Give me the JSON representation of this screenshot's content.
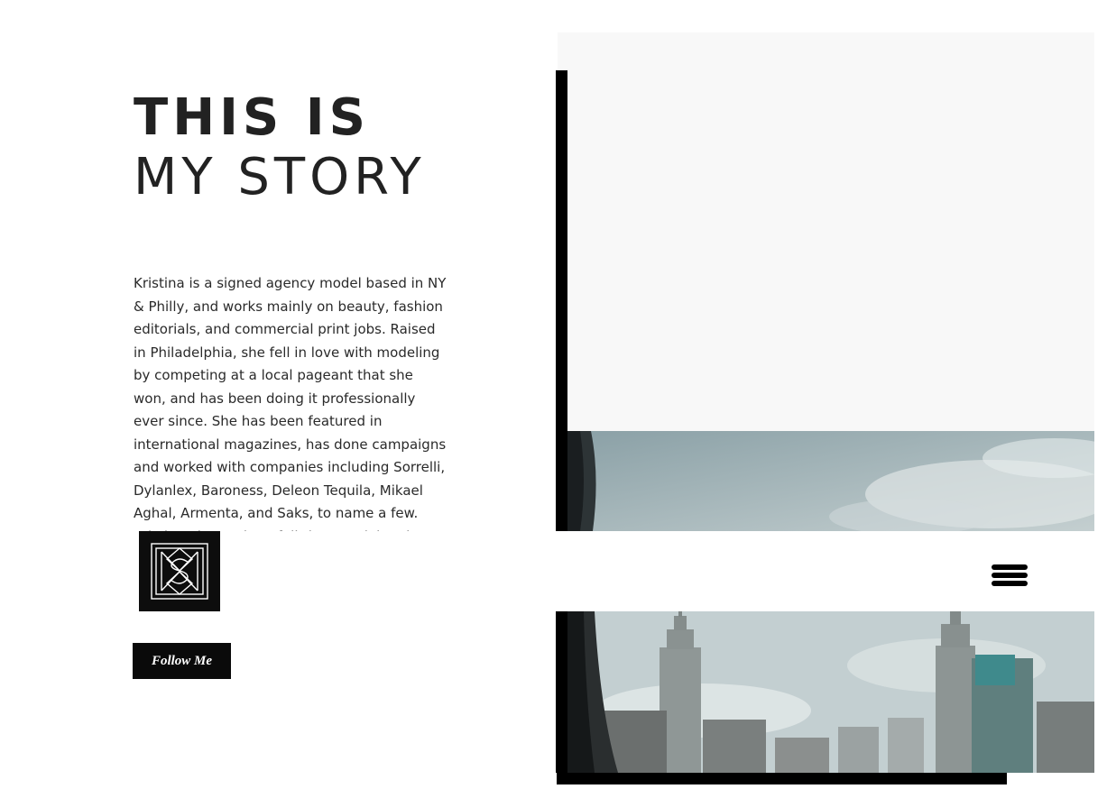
{
  "headline": {
    "line1": "THIS IS",
    "line2": "MY STORY"
  },
  "bio": {
    "text": "Kristina is a signed agency model based in NY & Philly, and works mainly on beauty, fashion editorials, and commercial print jobs. Raised in Philadelphia, she fell in love with modeling by competing at a local pageant that she won, and has been doing it professionally ever since. She has been featured in international magazines, has done campaigns and worked with companies including Sorrelli, Dylanlex, Baroness, Deleon Tequila, Mikael Aghal, Armenta, and Saks, to name a few. Kristina aims to be a full-time model and continue to grow her career."
  },
  "logo": {
    "icon": "monogram-logo-icon"
  },
  "follow_button": {
    "label": "Follow Me"
  },
  "menu": {
    "icon": "hamburger-menu-icon"
  },
  "colors": {
    "background": "#ffffff",
    "text": "#222222",
    "accent_black": "#000000",
    "panel_gray": "#f8f8f8",
    "sky": "#b9c6c8"
  }
}
